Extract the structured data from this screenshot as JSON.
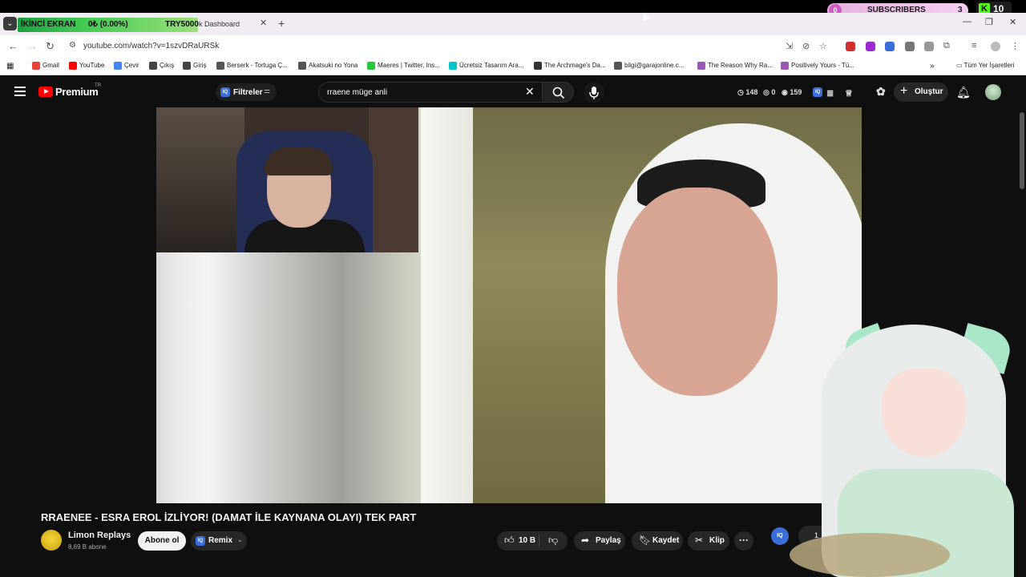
{
  "stream_overlay": {
    "banner_left": "İKİNCİ EKRAN",
    "banner_mid": "0₺ (0.00%)",
    "banner_right": "TRY5000",
    "subscribers_badge_count": "0",
    "subscribers_label": "SUBSCRIBERS",
    "subscribers_value": "3",
    "kick_count": "10"
  },
  "browser": {
    "tab_title": "k Dashboard",
    "url": "youtube.com/watch?v=1szvDRaURSk",
    "bookmarks": [
      {
        "label": "Gmail",
        "color": "#ea4335"
      },
      {
        "label": "YouTube",
        "color": "#ff0000"
      },
      {
        "label": "Çevir",
        "color": "#4285f4"
      },
      {
        "label": "Çıkış",
        "color": "#444444"
      },
      {
        "label": "Giriş",
        "color": "#444444"
      },
      {
        "label": "Berserk - Tortuga Ç...",
        "color": "#555555"
      },
      {
        "label": "Akatsuki no Yona",
        "color": "#555555"
      },
      {
        "label": "Maeres | Twitter, Ins...",
        "color": "#27c93f"
      },
      {
        "label": "Ücretsiz Tasarım Ara...",
        "color": "#00c4cc"
      },
      {
        "label": "The Archmage's Da...",
        "color": "#333333"
      },
      {
        "label": "bilgi@garajonline.c...",
        "color": "#555555"
      },
      {
        "label": "The Reason Why Ra...",
        "color": "#9b59b6"
      },
      {
        "label": "Positively Yours - Tü...",
        "color": "#9b59b6"
      }
    ],
    "all_bookmarks": "Tüm Yer İşaretleri"
  },
  "youtube": {
    "logo_text": "Premium",
    "logo_region": "TR",
    "filters_label": "Filtreler",
    "search_value": "rraene müge anli",
    "stat_views": "148",
    "stat_zero": "0",
    "stat_other": "159",
    "create_label": "Oluştur",
    "video_title": "RRAENEE - ESRA EROL İZLİYOR! (DAMAT İLE KAYNANA OLAYI) TEK PART",
    "channel_name": "Limon Replays",
    "channel_subs": "8,69 B abone",
    "subscribe_label": "Abone ol",
    "remix_label": "Remix",
    "like_count": "10 B",
    "share_label": "Paylaş",
    "save_label": "Kaydet",
    "clip_label": "Klip",
    "iq_label": "IQ",
    "partial_count": "1"
  }
}
